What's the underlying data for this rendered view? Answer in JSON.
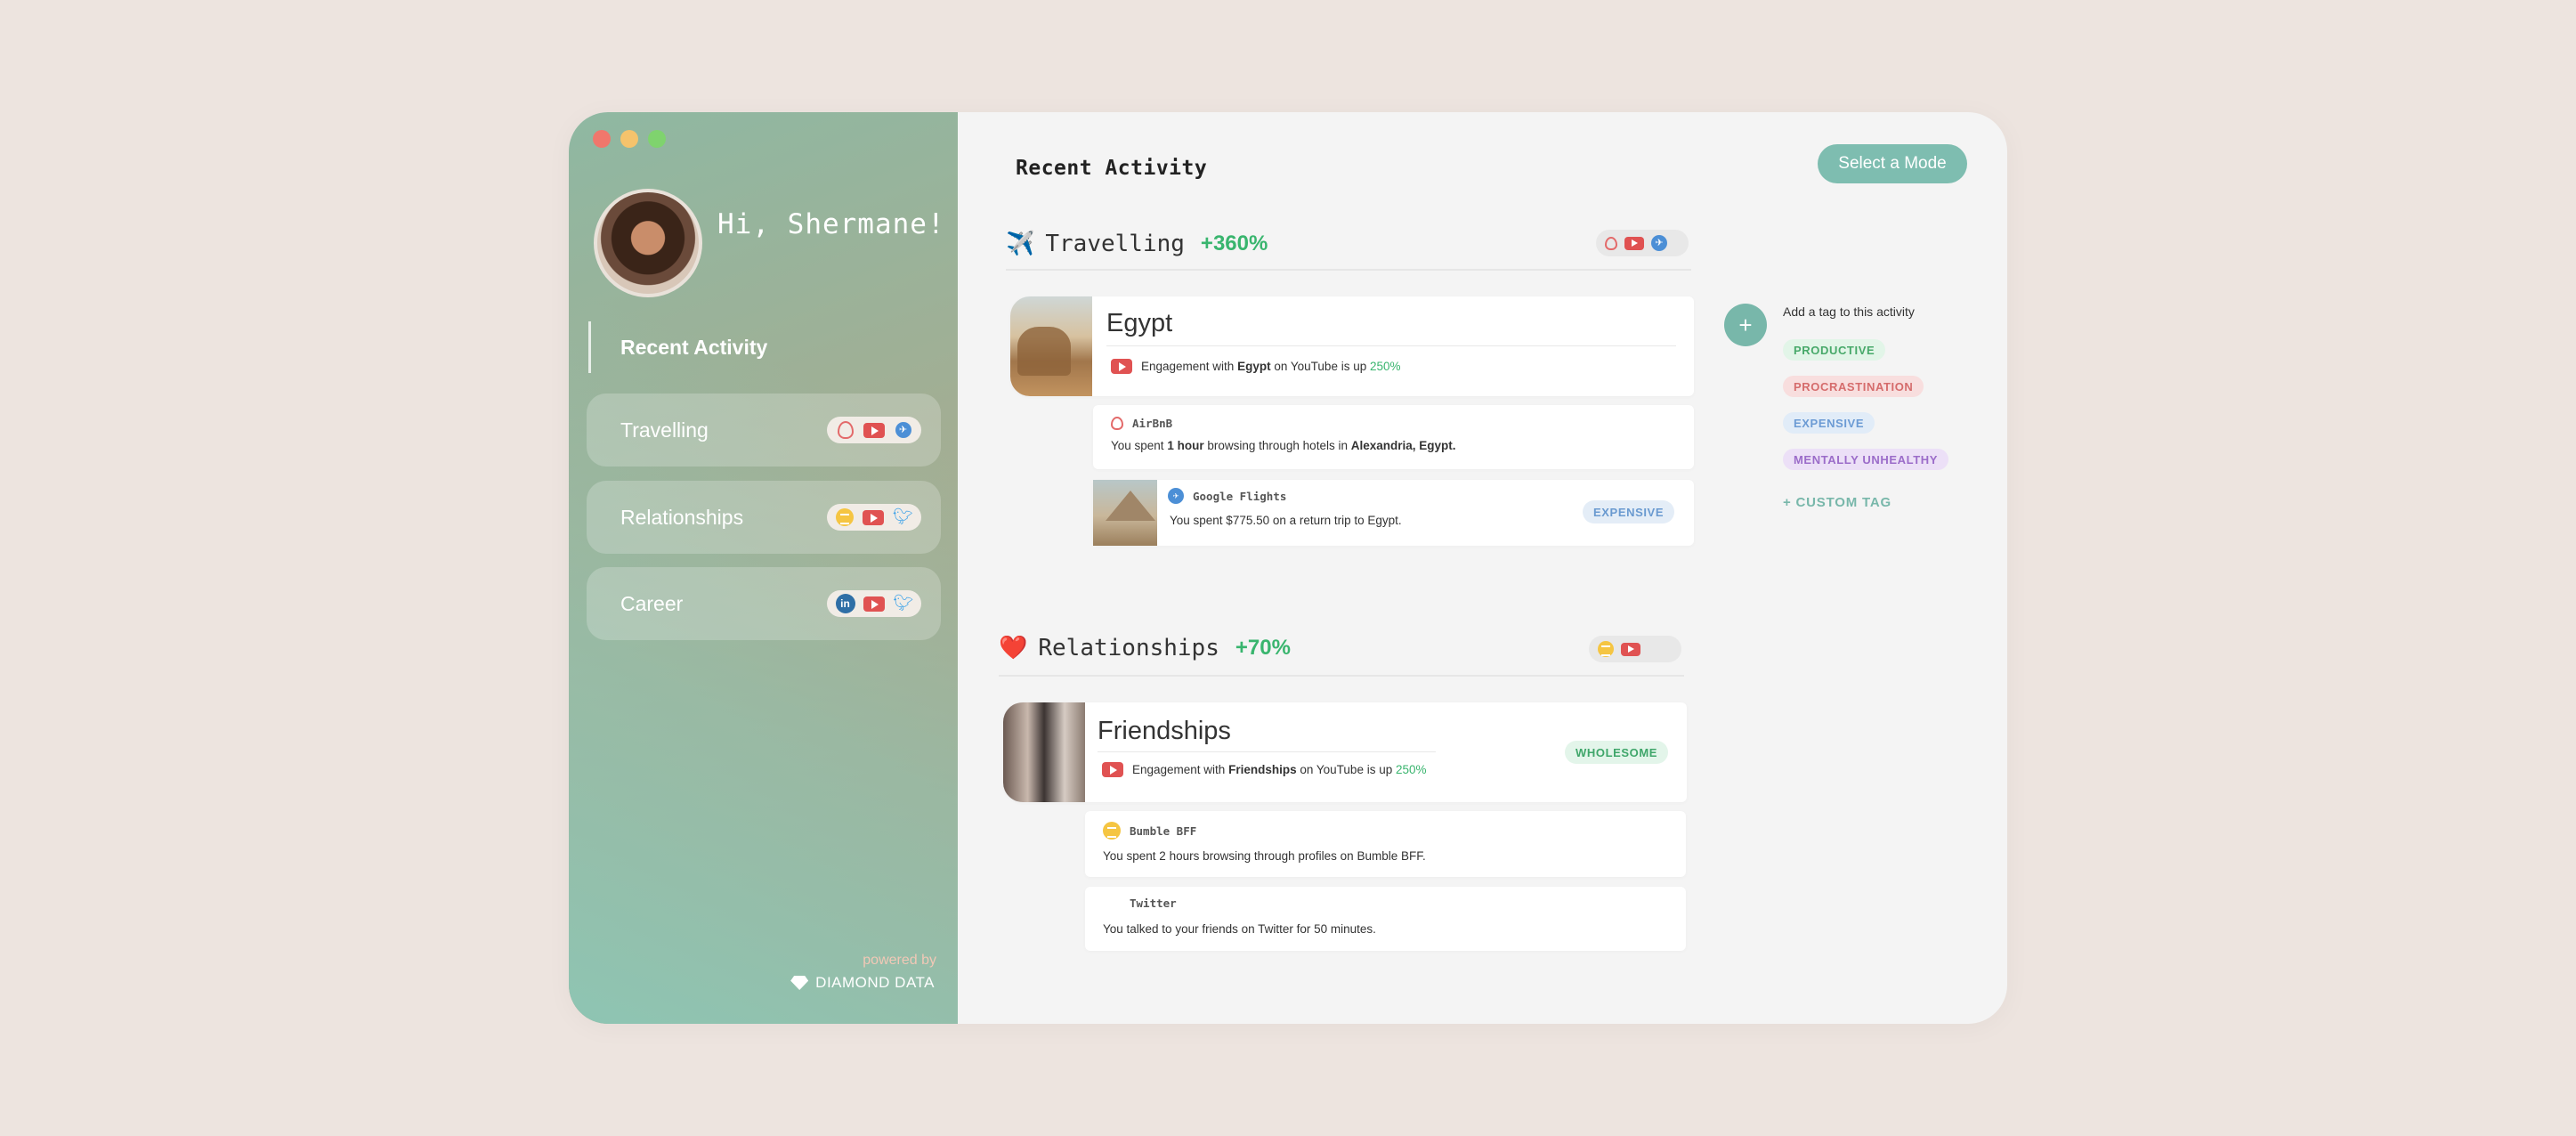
{
  "sidebar": {
    "greeting": "Hi, Shermane!",
    "active_nav": "Recent Activity",
    "items": [
      {
        "label": "Travelling",
        "icons": [
          "airbnb-icon",
          "youtube-icon",
          "google-flights-icon"
        ]
      },
      {
        "label": "Relationships",
        "icons": [
          "bumble-icon",
          "youtube-icon",
          "twitter-icon"
        ]
      },
      {
        "label": "Career",
        "icons": [
          "linkedin-icon",
          "youtube-icon",
          "twitter-icon"
        ]
      }
    ],
    "powered_by": "powered by",
    "brand": "DIAMOND DATA"
  },
  "main": {
    "title": "Recent Activity",
    "mode_button": "Select a Mode",
    "sections": [
      {
        "emoji": "✈️",
        "title": "Travelling",
        "change": "+360%",
        "highlight": {
          "title": "Egypt",
          "line_prefix": "Engagement with",
          "line_subject": "Egypt",
          "line_mid": "on YouTube is up",
          "line_pct": "250%"
        },
        "items": [
          {
            "source": "AirBnB",
            "pre": "You spent",
            "b1": "1 hour",
            "mid": "browsing through hotels in",
            "b2": "Alexandria, Egypt."
          },
          {
            "source": "Google Flights",
            "text": "You spent $775.50 on a return trip to Egypt.",
            "badge": "EXPENSIVE"
          }
        ]
      },
      {
        "emoji": "❤️",
        "title": "Relationships",
        "change": "+70%",
        "highlight": {
          "title": "Friendships",
          "line_prefix": "Engagement with",
          "line_subject": "Friendships",
          "line_mid": "on YouTube is up",
          "line_pct": "250%",
          "badge": "WHOLESOME"
        },
        "items": [
          {
            "source": "Bumble BFF",
            "text": "You spent 2 hours browsing through profiles on Bumble BFF."
          },
          {
            "source": "Twitter",
            "text": "You talked to your friends on Twitter for 50 minutes."
          }
        ]
      }
    ]
  },
  "tags_panel": {
    "hint": "Add a tag to this activity",
    "tags": [
      "PRODUCTIVE",
      "PROCRASTINATION",
      "EXPENSIVE",
      "MENTALLY UNHEALTHY"
    ],
    "custom": "+ CUSTOM TAG"
  }
}
